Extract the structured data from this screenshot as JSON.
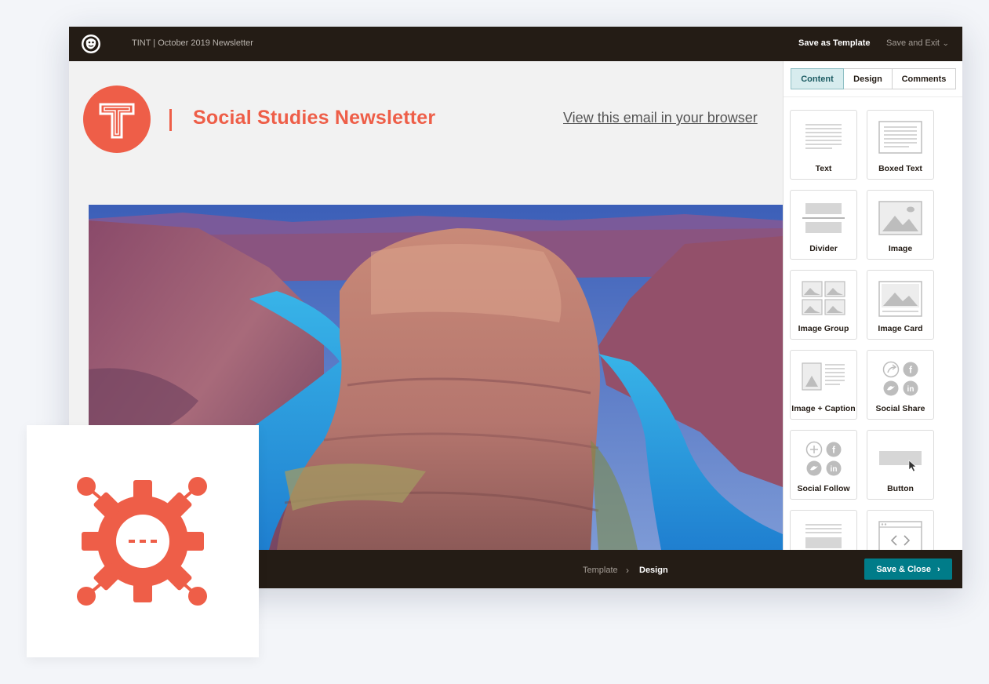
{
  "topbar": {
    "doc_title": "TINT | October 2019 Newsletter",
    "save_as_template": "Save as Template",
    "save_and_exit": "Save and Exit",
    "save_and_exit_icon": "chevron-down-icon"
  },
  "email": {
    "logo_letter": "T",
    "title": "Social Studies Newsletter",
    "view_in_browser": "View this email in your browser",
    "hero_alt": "Horseshoe Bend canyon with blue river"
  },
  "panel": {
    "tabs": [
      {
        "label": "Content",
        "active": true
      },
      {
        "label": "Design",
        "active": false
      },
      {
        "label": "Comments",
        "active": false
      }
    ],
    "blocks": [
      {
        "label": "Text",
        "icon": "text-block-icon"
      },
      {
        "label": "Boxed Text",
        "icon": "boxed-text-icon"
      },
      {
        "label": "Divider",
        "icon": "divider-icon"
      },
      {
        "label": "Image",
        "icon": "image-icon"
      },
      {
        "label": "Image Group",
        "icon": "image-group-icon"
      },
      {
        "label": "Image Card",
        "icon": "image-card-icon"
      },
      {
        "label": "Image + Caption",
        "icon": "image-caption-icon"
      },
      {
        "label": "Social Share",
        "icon": "social-share-icon"
      },
      {
        "label": "Social Follow",
        "icon": "social-follow-icon"
      },
      {
        "label": "Button",
        "icon": "button-block-icon"
      },
      {
        "label": "",
        "icon": "footer-block-icon"
      },
      {
        "label": "",
        "icon": "code-block-icon"
      }
    ]
  },
  "bottombar": {
    "crumb_template": "Template",
    "crumb_separator": "›",
    "crumb_design": "Design",
    "save_close": "Save & Close",
    "save_close_icon": "chevron-right-icon"
  },
  "colors": {
    "brand": "#ee5e48",
    "dark_bar": "#241c15",
    "accent_teal": "#007c89",
    "active_tab": "#d7ecee"
  },
  "badge": {
    "icon": "gear-integration-icon"
  }
}
